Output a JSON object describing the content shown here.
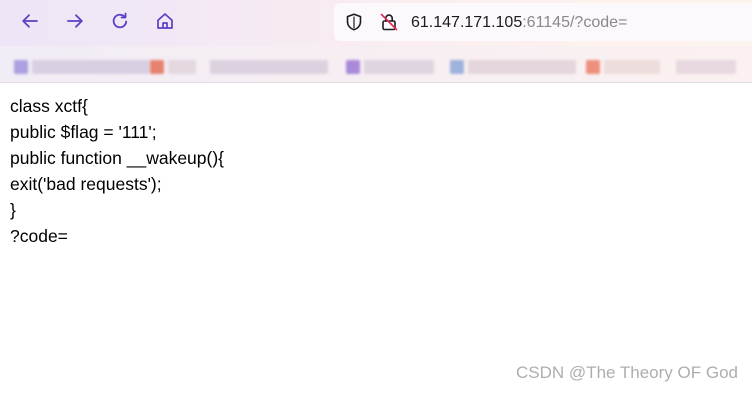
{
  "browser": {
    "url_host": "61.147.171.105",
    "url_rest": ":61145/?code=",
    "icons": {
      "back": "arrow-left-icon",
      "forward": "arrow-right-icon",
      "reload": "reload-icon",
      "home": "home-icon",
      "tracking_protection": "shield-icon",
      "insecure": "insecure-lock-icon"
    },
    "accent_color": "#5b3fc4"
  },
  "page": {
    "lines": [
      "class xctf{",
      "public $flag = '111';",
      "public function __wakeup(){",
      "exit('bad requests');",
      "}",
      "?code="
    ]
  },
  "watermark": "CSDN @The Theory OF God"
}
